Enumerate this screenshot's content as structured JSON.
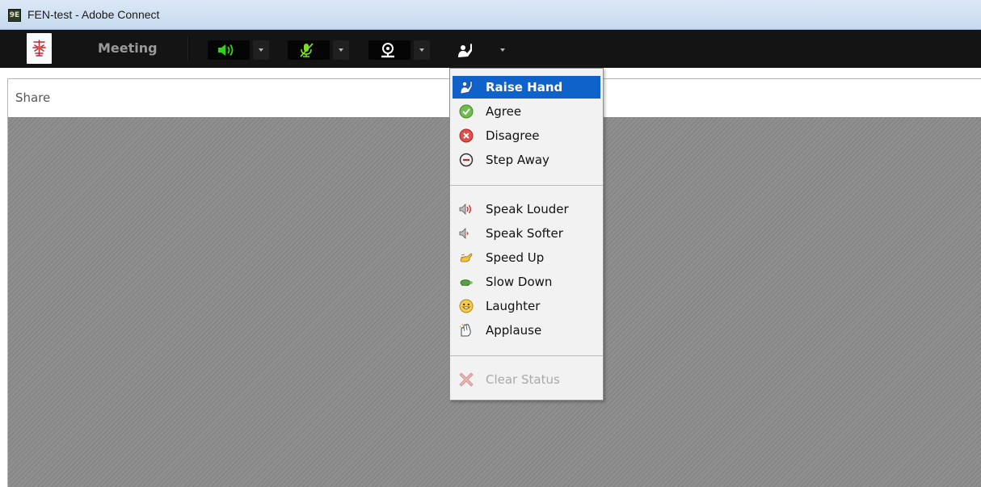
{
  "window": {
    "title": "FEN-test - Adobe Connect",
    "app_icon_text": "9E"
  },
  "toolbar": {
    "meeting_label": "Meeting",
    "speaker_icon": "speaker-icon",
    "microphone_icon": "microphone-muted-icon",
    "camera_icon": "webcam-icon",
    "status_icon": "raise-hand-icon",
    "speaker_color": "#33d11f",
    "microphone_color": "#7ddc1f"
  },
  "pod": {
    "title": "Share"
  },
  "status_menu": {
    "groups": [
      [
        {
          "label": "Raise Hand",
          "icon": "raise-hand-icon",
          "selected": true
        },
        {
          "label": "Agree",
          "icon": "check-circle-icon"
        },
        {
          "label": "Disagree",
          "icon": "x-circle-icon"
        },
        {
          "label": "Step Away",
          "icon": "minus-circle-icon"
        }
      ],
      [
        {
          "label": "Speak Louder",
          "icon": "speaker-loud-icon"
        },
        {
          "label": "Speak Softer",
          "icon": "speaker-soft-icon"
        },
        {
          "label": "Speed Up",
          "icon": "rabbit-icon"
        },
        {
          "label": "Slow Down",
          "icon": "turtle-icon"
        },
        {
          "label": "Laughter",
          "icon": "smiley-icon"
        },
        {
          "label": "Applause",
          "icon": "clapping-hands-icon"
        }
      ],
      [
        {
          "label": "Clear Status",
          "icon": "clear-x-icon",
          "disabled": true
        }
      ]
    ],
    "selected_color": "#0f62c9"
  }
}
